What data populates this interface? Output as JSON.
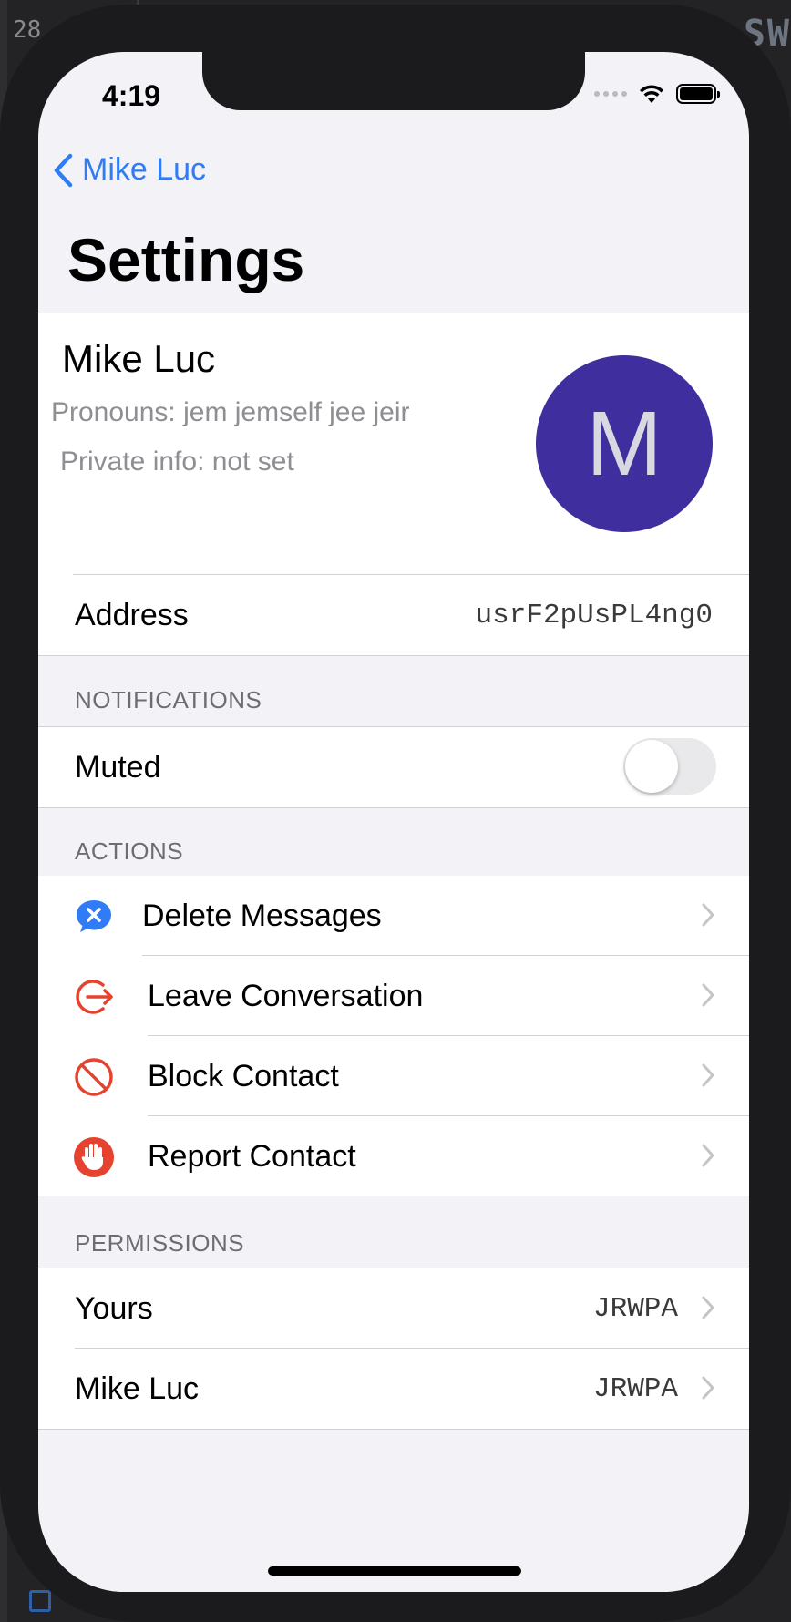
{
  "background": {
    "left_text": "28",
    "right_text": "SW"
  },
  "status_bar": {
    "time": "4:19"
  },
  "nav": {
    "back_label": "Mike Luc",
    "title": "Settings"
  },
  "profile": {
    "name": "Mike Luc",
    "pronouns": "Pronouns: jem jemself jee jeir",
    "private_info": "Private info: not set",
    "avatar_initial": "M",
    "avatar_color": "#3f2f9e"
  },
  "address": {
    "label": "Address",
    "value": "usrF2pUsPL4ng0"
  },
  "notifications": {
    "header": "NOTIFICATIONS",
    "muted_label": "Muted",
    "muted_on": false
  },
  "actions": {
    "header": "ACTIONS",
    "items": [
      {
        "label": "Delete Messages",
        "icon": "delete-messages-icon",
        "color": "#2f7cf6"
      },
      {
        "label": "Leave Conversation",
        "icon": "leave-conversation-icon",
        "color": "#e5432f"
      },
      {
        "label": "Block Contact",
        "icon": "block-icon",
        "color": "#e5432f"
      },
      {
        "label": "Report Contact",
        "icon": "report-hand-icon",
        "color": "#e5432f"
      }
    ]
  },
  "permissions": {
    "header": "PERMISSIONS",
    "items": [
      {
        "label": "Yours",
        "value": "JRWPA"
      },
      {
        "label": "Mike Luc",
        "value": "JRWPA"
      }
    ]
  },
  "colors": {
    "accent": "#2f7cf6",
    "destructive": "#e5432f",
    "grouped_background": "#f2f2f7"
  }
}
